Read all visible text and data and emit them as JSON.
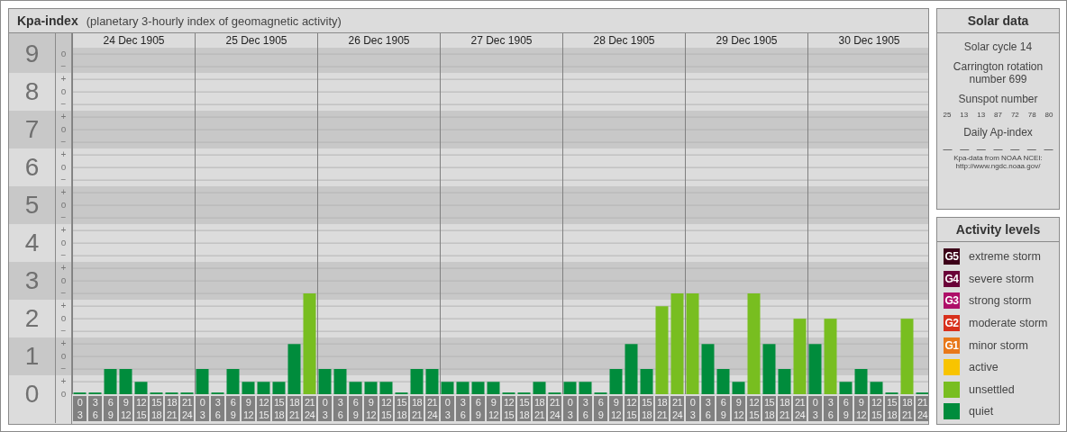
{
  "kp_panel": {
    "title": "Kpa-index",
    "subtitle": "(planetary 3-hourly index of geomagnetic activity)",
    "dates": [
      "24 Dec 1905",
      "25 Dec 1905",
      "26 Dec 1905",
      "27 Dec 1905",
      "28 Dec 1905",
      "29 Dec 1905",
      "30 Dec 1905"
    ],
    "scale_marks": [
      [
        "o",
        "−"
      ],
      [
        "+",
        "o",
        "−"
      ],
      [
        "+",
        "o",
        "−"
      ],
      [
        "+",
        "o",
        "−"
      ],
      [
        "+",
        "o",
        "−"
      ],
      [
        "+",
        "o",
        "−"
      ],
      [
        "+",
        "o",
        "−"
      ],
      [
        "+",
        "o",
        "−"
      ],
      [
        "+",
        "o",
        "−"
      ],
      [
        "+",
        "o"
      ]
    ],
    "chart_data": {
      "type": "bar",
      "grid": true,
      "ylim": [
        0,
        9.17
      ],
      "yticks": [
        {
          "value": 0,
          "label": "0"
        },
        {
          "value": 1,
          "label": "1"
        },
        {
          "value": 2,
          "label": "2"
        },
        {
          "value": 3,
          "label": "3"
        },
        {
          "value": 4,
          "label": "4"
        },
        {
          "value": 5,
          "label": "5"
        },
        {
          "value": 6,
          "label": "6"
        },
        {
          "value": 7,
          "label": "7"
        },
        {
          "value": 8,
          "label": "8"
        },
        {
          "value": 9,
          "label": "9"
        }
      ],
      "categories": [
        "0\n3",
        "3\n6",
        "6\n9",
        "9\n12",
        "12\n15",
        "15\n18",
        "18\n21",
        "21\n24",
        "0\n3",
        "3\n6",
        "6\n9",
        "9\n12",
        "12\n15",
        "15\n18",
        "18\n21",
        "21\n24",
        "0\n3",
        "3\n6",
        "6\n9",
        "9\n12",
        "12\n15",
        "15\n18",
        "18\n21",
        "21\n24",
        "0\n3",
        "3\n6",
        "6\n9",
        "9\n12",
        "12\n15",
        "15\n18",
        "18\n21",
        "21\n24",
        "0\n3",
        "3\n6",
        "6\n9",
        "9\n12",
        "12\n15",
        "15\n18",
        "18\n21",
        "21\n24",
        "0\n3",
        "3\n6",
        "6\n9",
        "9\n12",
        "12\n15",
        "15\n18",
        "18\n21",
        "21\n24",
        "0\n3",
        "3\n6",
        "6\n9",
        "9\n12",
        "12\n15",
        "15\n18",
        "18\n21",
        "21\n24"
      ],
      "series": [
        {
          "color": "#008c3c",
          "values": [
            0,
            0,
            0.67,
            0.67,
            0.33,
            0,
            0,
            0,
            0.67,
            0,
            0.67,
            0.33,
            0.33,
            0.33,
            1.33,
            null,
            0.67,
            0.67,
            0.33,
            0.33,
            0.33,
            0,
            0.67,
            0.67,
            0.33,
            0.33,
            0.33,
            0.33,
            0,
            0,
            0.33,
            0,
            0.33,
            0.33,
            0,
            0.67,
            1.33,
            0.67,
            null,
            null,
            null,
            1.33,
            0.67,
            0.33,
            null,
            1.33,
            0.67,
            null,
            1.33,
            null,
            0.33,
            0.67,
            0.33,
            0,
            null,
            0
          ]
        },
        {
          "color": "#78be20",
          "values": [
            null,
            null,
            null,
            null,
            null,
            null,
            null,
            null,
            null,
            null,
            null,
            null,
            null,
            null,
            null,
            2.67,
            null,
            null,
            null,
            null,
            null,
            null,
            null,
            null,
            null,
            null,
            null,
            null,
            null,
            null,
            null,
            null,
            null,
            null,
            null,
            null,
            null,
            null,
            2.33,
            2.67,
            2.67,
            null,
            null,
            null,
            2.67,
            null,
            null,
            2,
            null,
            2,
            null,
            null,
            null,
            null,
            2,
            null
          ]
        }
      ]
    }
  },
  "solar_data": {
    "title": "Solar data",
    "cycle": "Solar cycle 14",
    "rotation": "Carrington rotation number 699",
    "sunspot_label": "Sunspot number",
    "sunspots": [
      "25",
      "13",
      "13",
      "87",
      "72",
      "78",
      "80"
    ],
    "ap_label": "Daily Ap-index",
    "ap_values": [
      "—",
      "—",
      "—",
      "—",
      "—",
      "—",
      "—"
    ],
    "source": "Kpa-data from NOAA NCEI:",
    "source_link": "http://www.ngdc.noaa.gov/"
  },
  "activity_levels": {
    "title": "Activity levels",
    "items": [
      {
        "badge": "G5",
        "label": "extreme storm",
        "color": "#3c0018"
      },
      {
        "badge": "G4",
        "label": "severe storm",
        "color": "#6a0038"
      },
      {
        "badge": "G3",
        "label": "strong storm",
        "color": "#ae0e68"
      },
      {
        "badge": "G2",
        "label": "moderate storm",
        "color": "#d8301c"
      },
      {
        "badge": "G1",
        "label": "minor storm",
        "color": "#e8781a"
      },
      {
        "label": "active",
        "color": "#f8c400"
      },
      {
        "label": "unsettled",
        "color": "#78be20"
      },
      {
        "label": "quiet",
        "color": "#008c3c"
      }
    ]
  }
}
